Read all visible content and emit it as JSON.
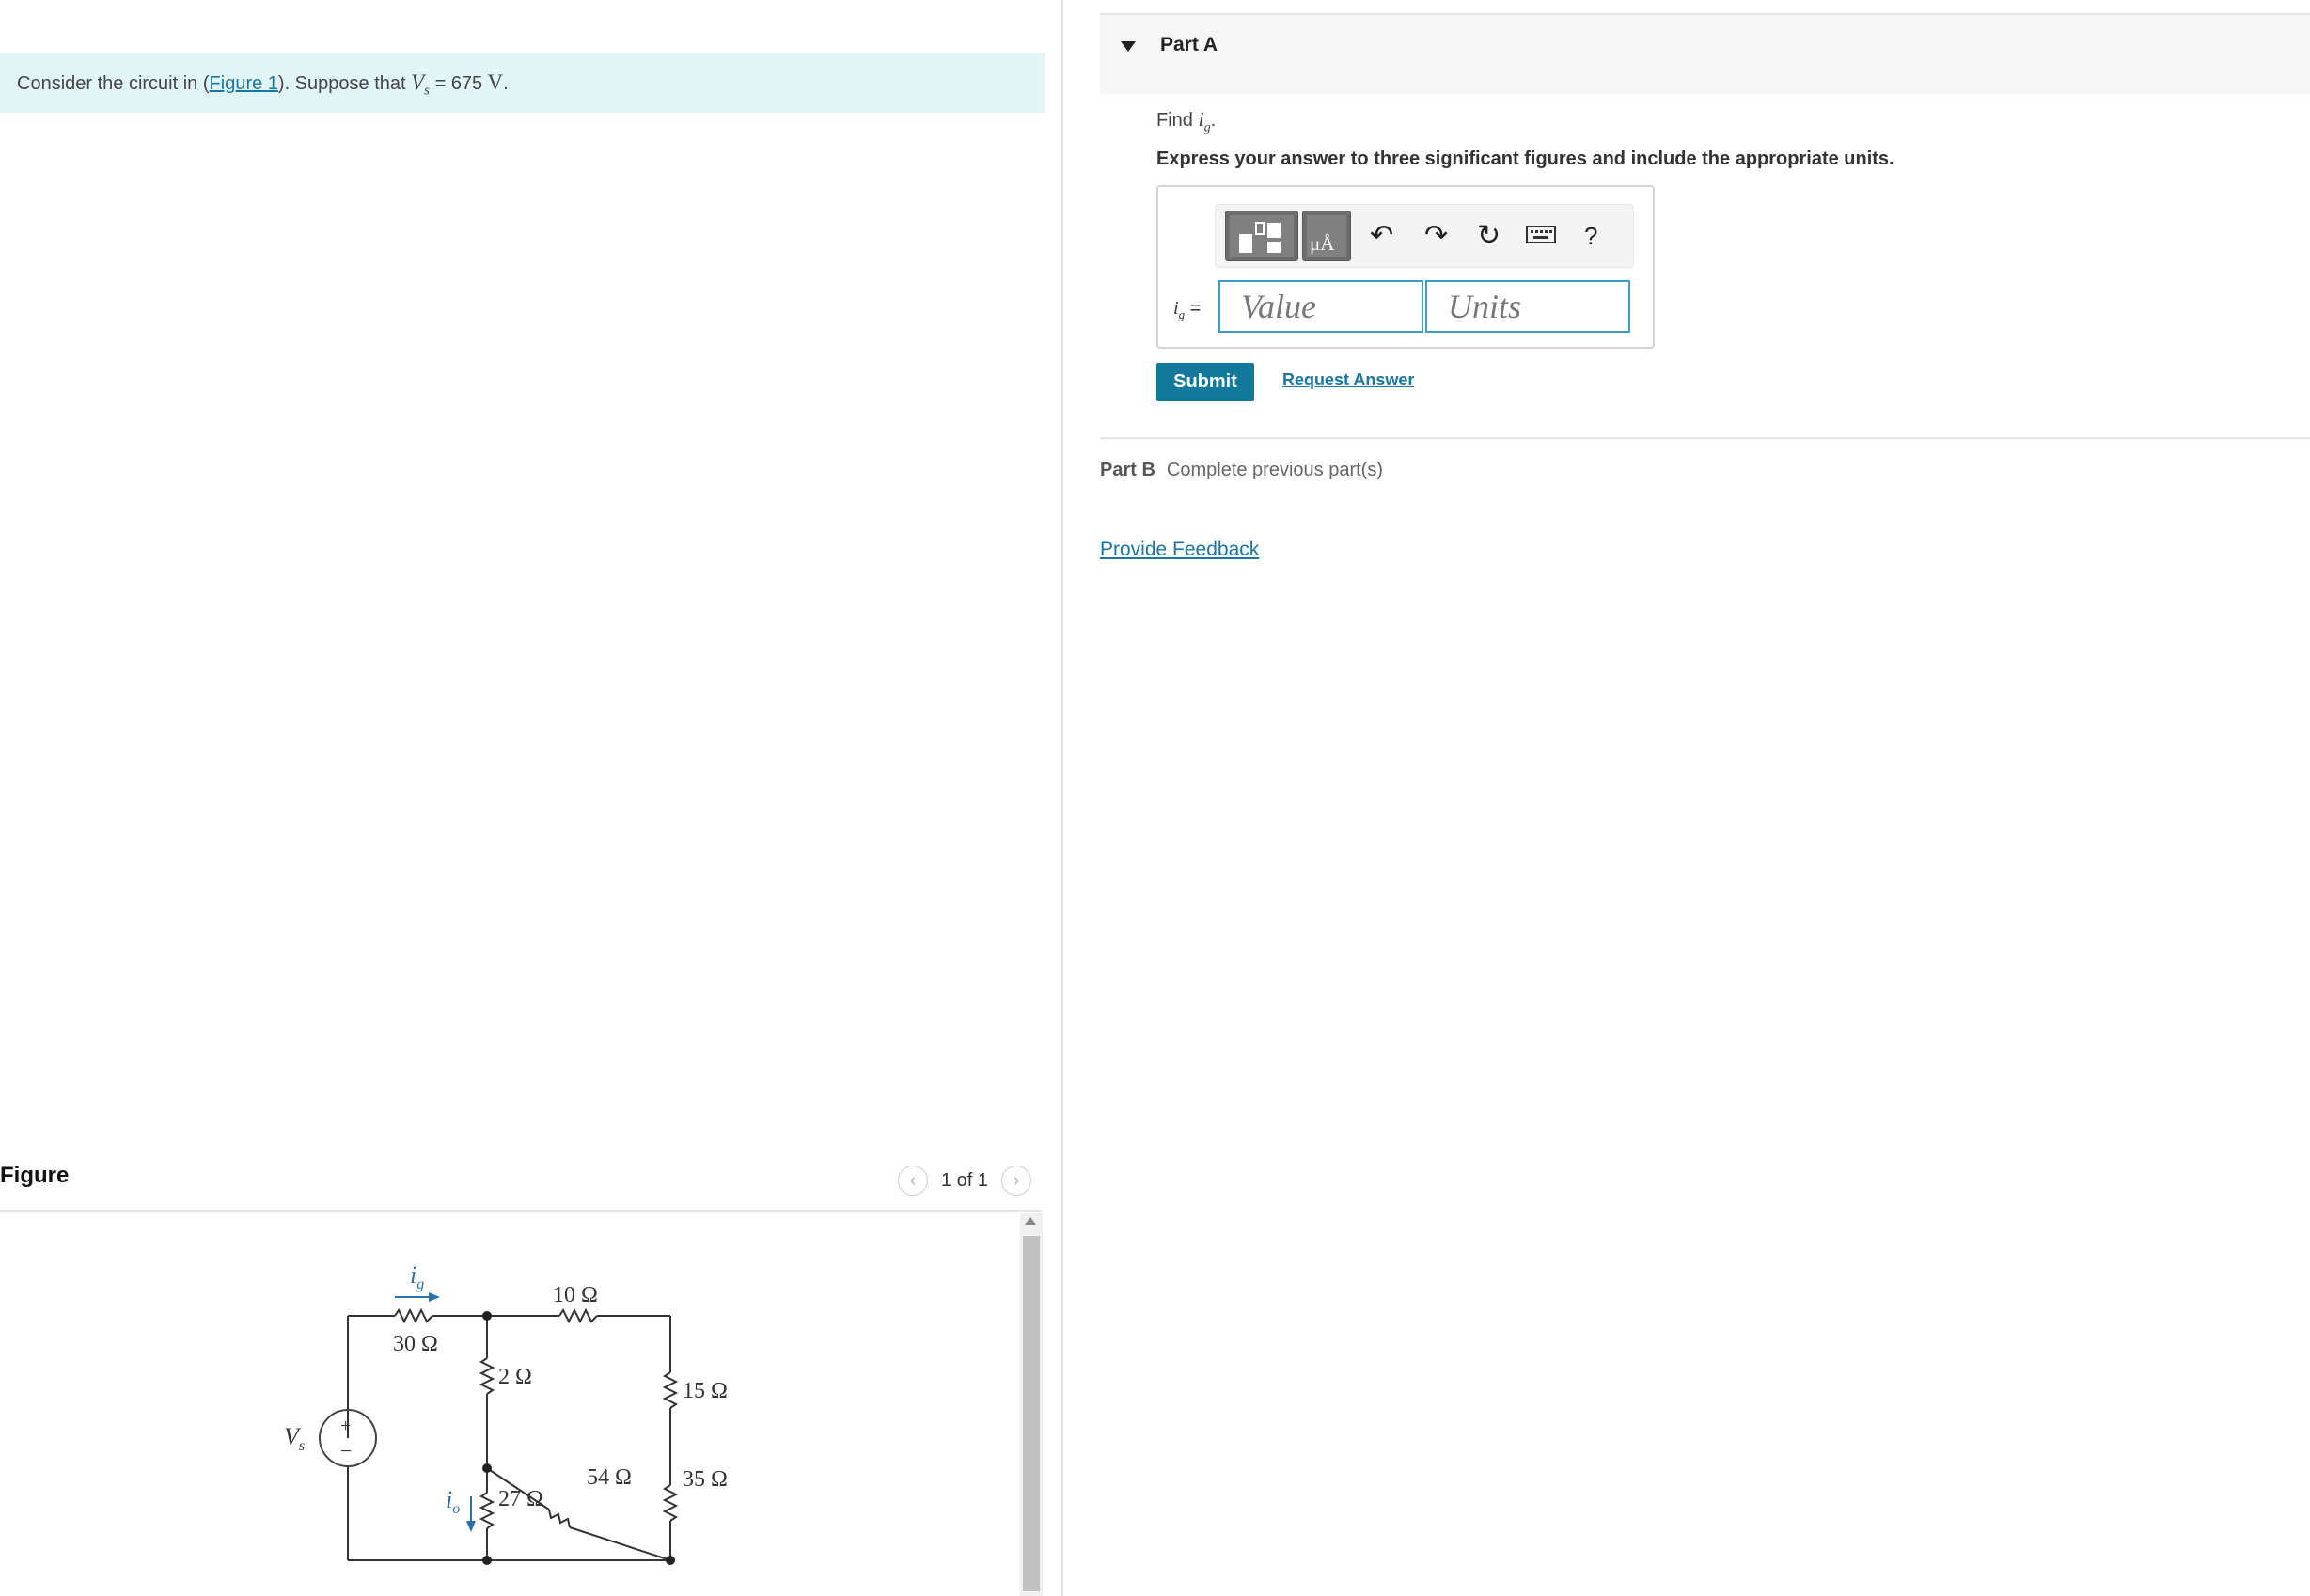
{
  "intro": {
    "prefix": "Consider the circuit in (",
    "figure_link": "Figure 1",
    "middle": "). Suppose that ",
    "var_base": "V",
    "var_sub": "s",
    "equals": " = ",
    "value": "675",
    "unit": "V",
    "suffix": "."
  },
  "figure": {
    "title": "Figure",
    "counter": "1 of 1",
    "prev_icon": "chevron-left-icon",
    "next_icon": "chevron-right-icon",
    "circuit": {
      "source_label_base": "V",
      "source_label_sub": "s",
      "ig_base": "i",
      "ig_sub": "g",
      "io_base": "i",
      "io_sub": "o",
      "r30": "30 Ω",
      "r10": "10 Ω",
      "r2": "2 Ω",
      "r15": "15 Ω",
      "r54": "54 Ω",
      "r35": "35 Ω",
      "r27": "27 Ω",
      "plus": "+",
      "minus": "−"
    }
  },
  "part_a": {
    "title": "Part A",
    "find_prefix": "Find ",
    "find_var_base": "i",
    "find_var_sub": "g",
    "find_suffix": ".",
    "instruction": "Express your answer to three significant figures and include the appropriate units.",
    "answer_label_base": "i",
    "answer_label_sub": "g",
    "answer_label_eq": " =",
    "value_placeholder": "Value",
    "units_placeholder": "Units",
    "units_tile_text": "μÅ",
    "toolbar_icons": [
      "templates-icon",
      "units-icon",
      "undo-icon",
      "redo-icon",
      "reset-icon",
      "keyboard-icon",
      "help-icon"
    ],
    "help_text": "?",
    "submit_label": "Submit",
    "request_label": "Request Answer"
  },
  "part_b": {
    "title": "Part B",
    "status": "Complete previous part(s)"
  },
  "feedback_label": "Provide Feedback",
  "colors": {
    "accent": "#12789c",
    "link": "#1877a8",
    "intro_bg": "#e2f5f6",
    "input_border": "#3a9ec8"
  }
}
